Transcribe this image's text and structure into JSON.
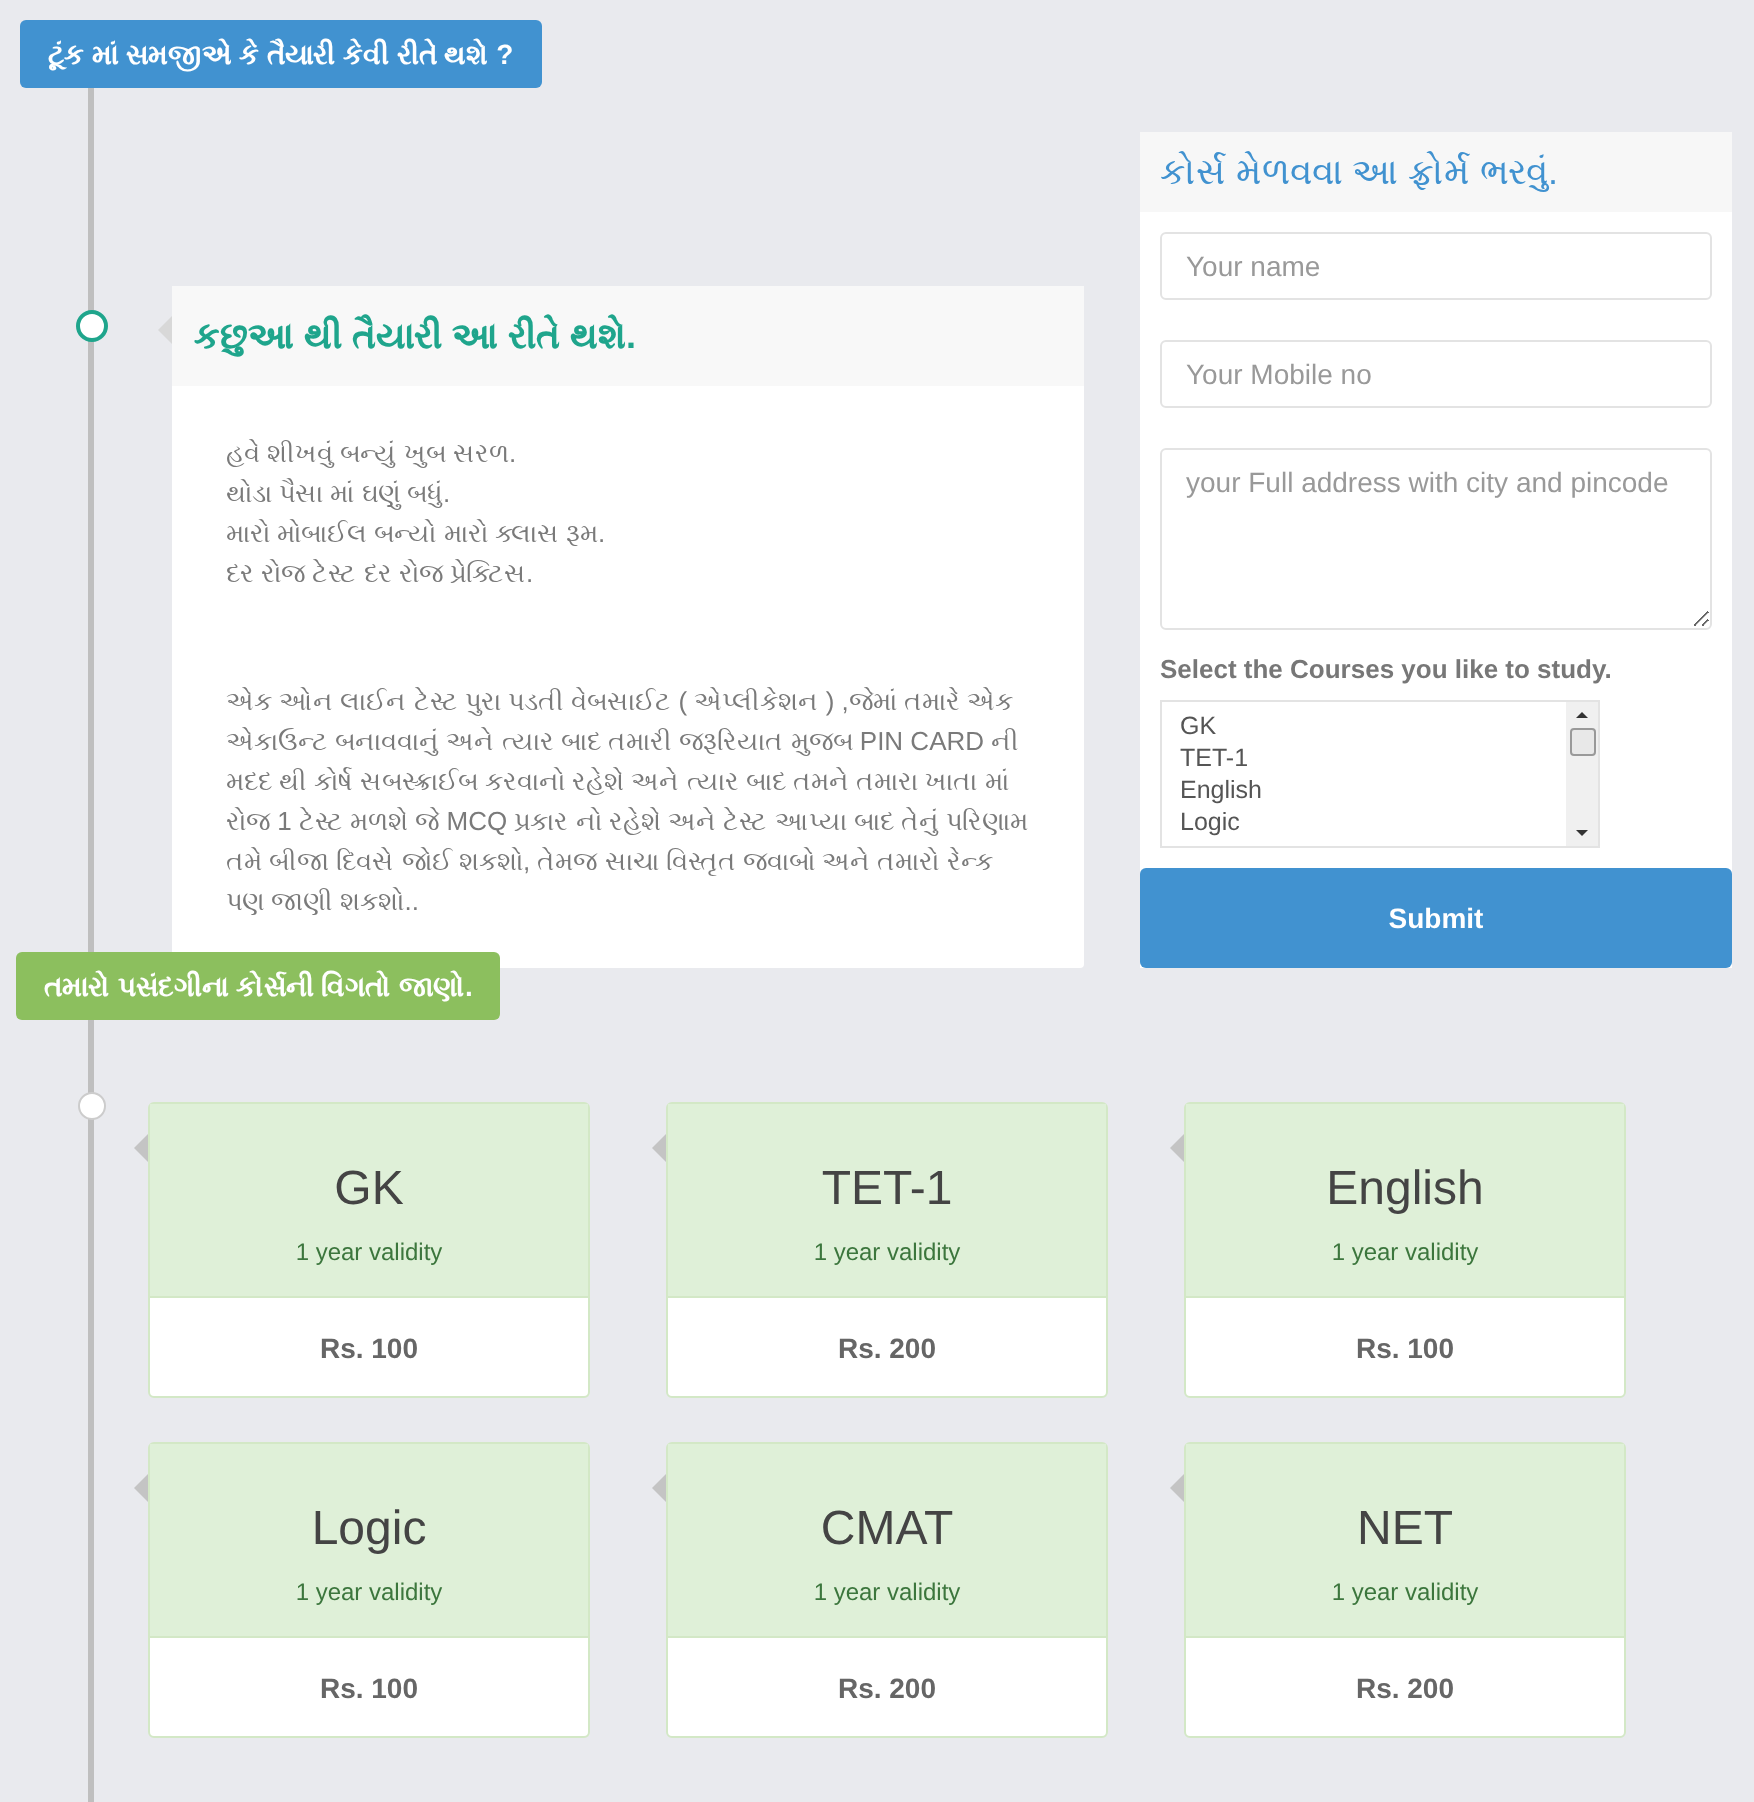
{
  "intro_badge": "ટૂંક માં સમજીએ કે તૈયારી કેવી રીતે થશે ?",
  "how_card": {
    "title": "કછુઆ થી તૈયારી આ રીતે થશે.",
    "lines": [
      "હવે શીખવું બન્યું ખુબ સરળ.",
      "થોડા પૈસા માં ઘણું બધું.",
      "મારો મોબાઈલ બન્યો મારો ક્લાસ રૂમ.",
      "દર રોજ ટેસ્ટ દર રોજ પ્રેક્ટિસ."
    ],
    "description": "એક ઓન લાઈન ટેસ્ટ પુરા પડતી વેબસાઈટ ( એપ્લીકેશન ) ,જેમાં તમારે એક એકાઉન્ટ બનાવવાનું અને ત્યાર બાદ તમારી જરૂરિયાત મુજબ PIN CARD ની મદદ થી કોર્ષ સબસ્ક્રાઈબ કરવાનો રહેશે અને ત્યાર બાદ તમને તમારા ખાતા માં રોજ 1 ટેસ્ટ મળશે જે MCQ પ્રકાર નો રહેશે અને ટેસ્ટ આપ્યા બાદ તેનું પરિણામ તમે બીજા દિવસે જોઈ શકશો, તેમજ સાચા વિસ્તૃત જવાબો અને તમારો રેન્ક પણ જાણી શકશો.."
  },
  "form": {
    "title": "કોર્સ મેળવવા આ ફ્રોર્મ ભરવું.",
    "name_placeholder": "Your name",
    "mobile_placeholder": "Your Mobile no",
    "address_placeholder": "your Full address with city and pincode",
    "courses_label": "Select the Courses you like to study.",
    "course_options": [
      "GK",
      "TET-1",
      "English",
      "Logic"
    ],
    "submit": "Submit"
  },
  "courses_badge": "તમારો પસંદગીના કોર્સની વિગતો જાણો.",
  "courses": [
    {
      "name": "GK",
      "validity": "1 year validity",
      "price": "Rs. 100"
    },
    {
      "name": "TET-1",
      "validity": "1 year validity",
      "price": "Rs. 200"
    },
    {
      "name": "English",
      "validity": "1 year validity",
      "price": "Rs. 100"
    },
    {
      "name": "Logic",
      "validity": "1 year validity",
      "price": "Rs. 100"
    },
    {
      "name": "CMAT",
      "validity": "1 year validity",
      "price": "Rs. 200"
    },
    {
      "name": "NET",
      "validity": "1 year validity",
      "price": "Rs. 200"
    }
  ]
}
